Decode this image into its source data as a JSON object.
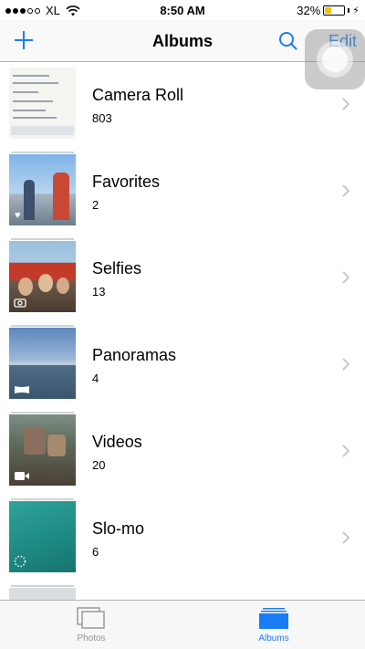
{
  "status_bar": {
    "carrier": "XL",
    "time": "8:50 AM",
    "battery_percent": "32%",
    "battery_level": 0.32
  },
  "nav": {
    "title": "Albums",
    "edit_label": "Edit"
  },
  "albums": [
    {
      "name": "Camera Roll",
      "count": "803",
      "thumb_icon": "screenshot-thumbnail"
    },
    {
      "name": "Favorites",
      "count": "2",
      "thumb_icon": "heart-icon"
    },
    {
      "name": "Selfies",
      "count": "13",
      "thumb_icon": "front-camera-icon"
    },
    {
      "name": "Panoramas",
      "count": "4",
      "thumb_icon": "panorama-icon"
    },
    {
      "name": "Videos",
      "count": "20",
      "thumb_icon": "video-camera-icon"
    },
    {
      "name": "Slo-mo",
      "count": "6",
      "thumb_icon": "slomo-icon"
    }
  ],
  "tabs": [
    {
      "label": "Photos",
      "selected": false
    },
    {
      "label": "Albums",
      "selected": true
    }
  ],
  "colors": {
    "accent": "#1a7cf5",
    "battery": "#f5c400",
    "inactive_tab": "#929292"
  }
}
